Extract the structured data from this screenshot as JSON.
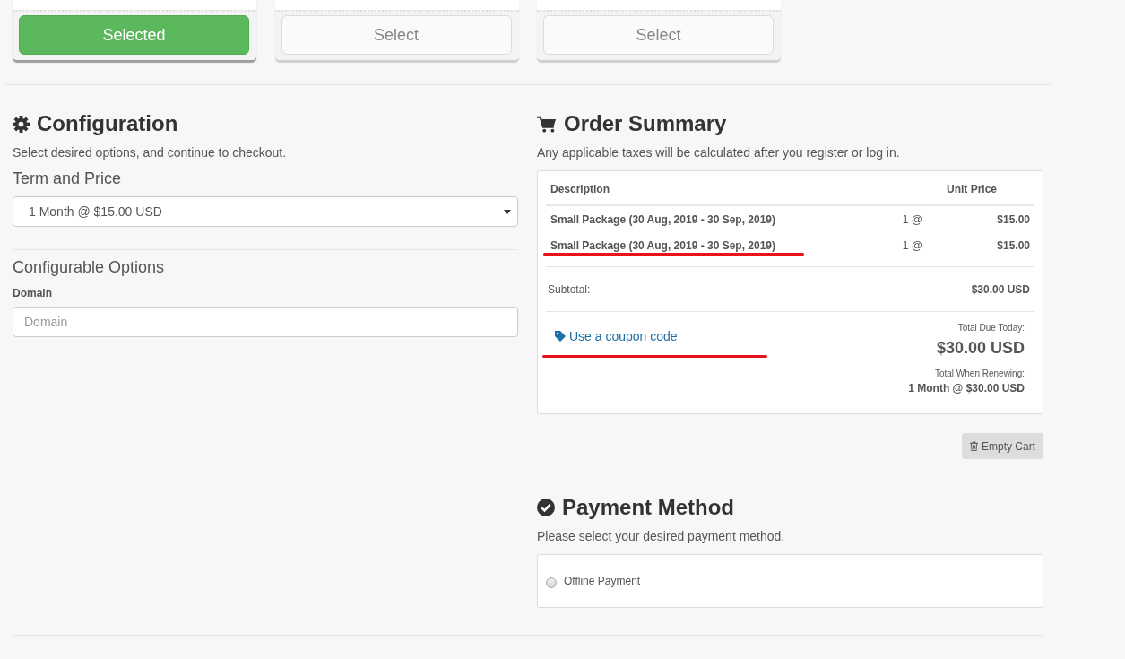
{
  "plans": [
    {
      "button": "Selected",
      "selected": true
    },
    {
      "button": "Select",
      "selected": false
    },
    {
      "button": "Select",
      "selected": false
    }
  ],
  "configuration": {
    "title": "Configuration",
    "subtitle": "Select desired options, and continue to checkout.",
    "term_label": "Term and Price",
    "term_select": {
      "value": "1 Month @ $15.00 USD"
    },
    "options_title": "Configurable Options",
    "domain": {
      "label": "Domain",
      "placeholder": "Domain"
    }
  },
  "order_summary": {
    "title": "Order Summary",
    "subtitle": "Any applicable taxes will be calculated after you register or log in.",
    "columns": [
      "Description",
      "Unit Price"
    ],
    "items": [
      {
        "description": "Small Package (30 Aug, 2019 - 30 Sep, 2019)",
        "quantity": "1 @",
        "price": "$15.00",
        "underlined": false
      },
      {
        "description": "Small Package (30 Aug, 2019 - 30 Sep, 2019)",
        "quantity": "1 @",
        "price": "$15.00",
        "underlined": true
      }
    ],
    "subtotal": {
      "label": "Subtotal:",
      "value": "$30.00 USD"
    },
    "coupon": {
      "label": "Use a coupon code",
      "underlined": true
    },
    "total_due": {
      "label": "Total Due Today:",
      "value": "$30.00 USD"
    },
    "total_renewing": {
      "label": "Total When Renewing:",
      "value": "1 Month @ $30.00 USD"
    },
    "empty_cart": "Empty Cart"
  },
  "payment": {
    "title": "Payment Method",
    "subtitle": "Please select your desired payment method.",
    "options": [
      {
        "label": "Offline Payment",
        "selected": false
      }
    ]
  }
}
